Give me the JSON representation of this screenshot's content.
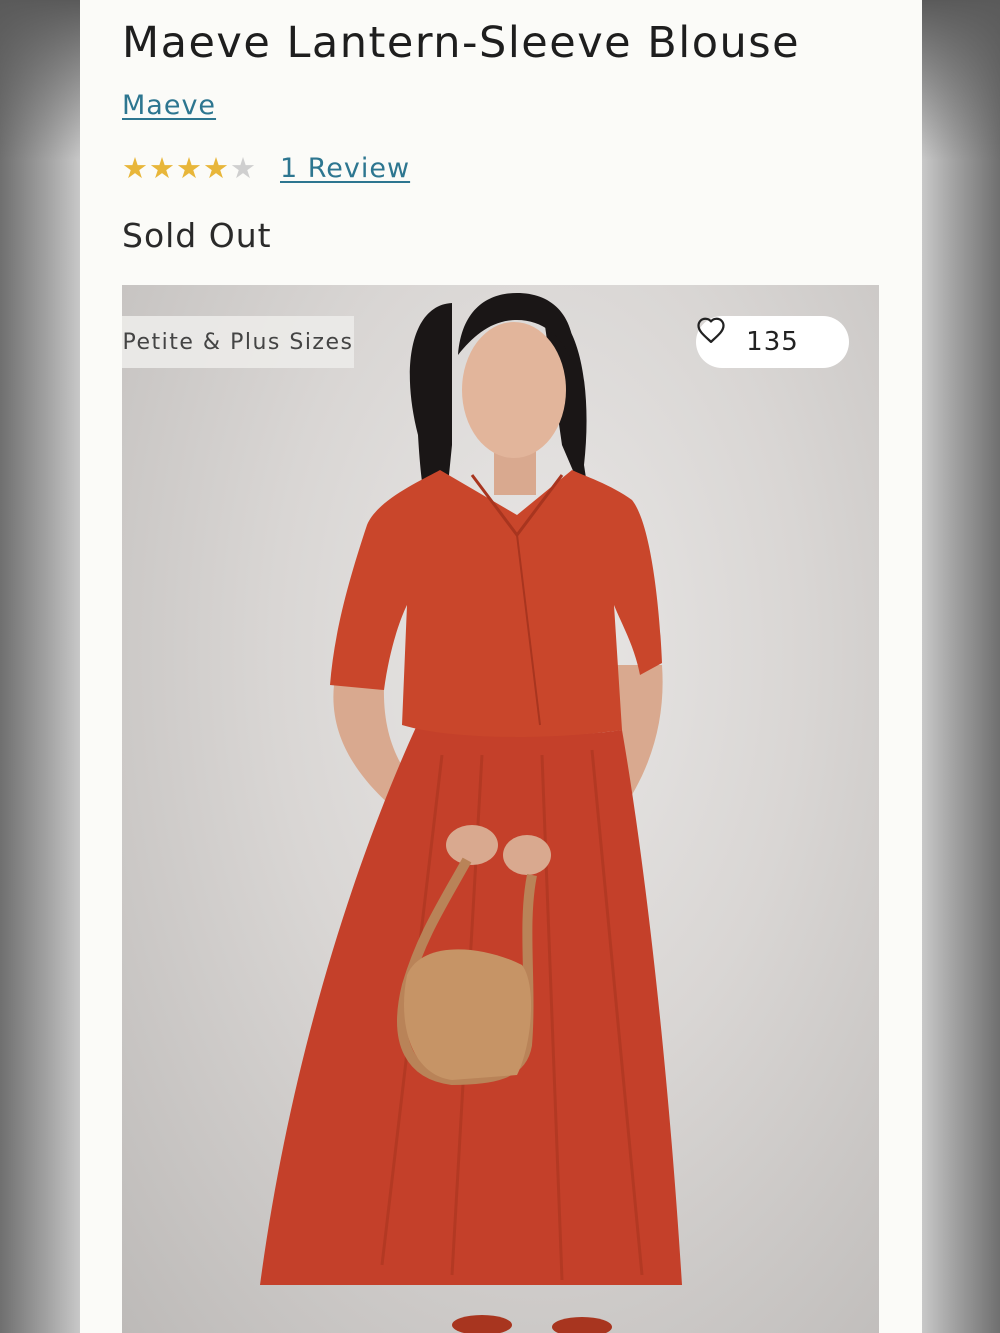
{
  "product": {
    "title": "Maeve Lantern-Sleeve Blouse",
    "brand": "Maeve",
    "rating": 4,
    "rating_max": 5,
    "reviews_label": "1 Review",
    "availability": "Sold Out"
  },
  "gallery": {
    "badge": "Petite & Plus Sizes",
    "favorites_count": "135",
    "favorite_icon": "heart-icon"
  },
  "colors": {
    "link": "#2d7690",
    "star_filled": "#e8b63a",
    "star_empty": "#cfcfcf",
    "garment": "#c9462b"
  }
}
